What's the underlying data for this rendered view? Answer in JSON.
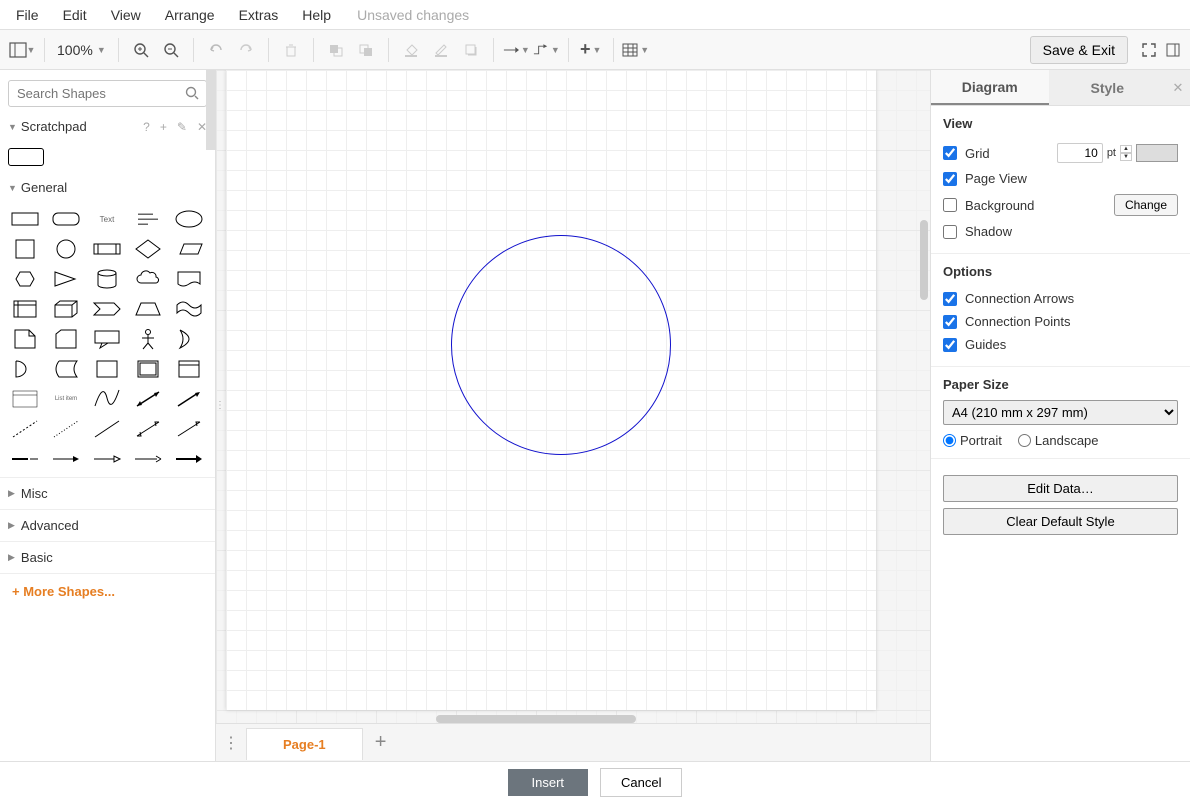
{
  "menubar": {
    "items": [
      "File",
      "Edit",
      "View",
      "Arrange",
      "Extras",
      "Help"
    ],
    "status": "Unsaved changes"
  },
  "toolbar": {
    "zoom": "100%",
    "save_exit": "Save & Exit"
  },
  "search": {
    "placeholder": "Search Shapes"
  },
  "scratchpad": {
    "title": "Scratchpad"
  },
  "sections": {
    "general": "General",
    "misc": "Misc",
    "advanced": "Advanced",
    "basic": "Basic",
    "more": "+  More Shapes..."
  },
  "pages": {
    "active": "Page-1"
  },
  "right_panel": {
    "tabs": {
      "diagram": "Diagram",
      "style": "Style"
    },
    "view": {
      "title": "View",
      "grid": "Grid",
      "grid_size": "10",
      "grid_unit": "pt",
      "page_view": "Page View",
      "background": "Background",
      "change": "Change",
      "shadow": "Shadow"
    },
    "options": {
      "title": "Options",
      "conn_arrows": "Connection Arrows",
      "conn_points": "Connection Points",
      "guides": "Guides"
    },
    "paper": {
      "title": "Paper Size",
      "selected": "A4 (210 mm x 297 mm)",
      "portrait": "Portrait",
      "landscape": "Landscape"
    },
    "actions": {
      "edit_data": "Edit Data…",
      "clear_style": "Clear Default Style"
    }
  },
  "bottom": {
    "insert": "Insert",
    "cancel": "Cancel"
  },
  "shape_labels": {
    "text": "Text",
    "list": "List item"
  }
}
